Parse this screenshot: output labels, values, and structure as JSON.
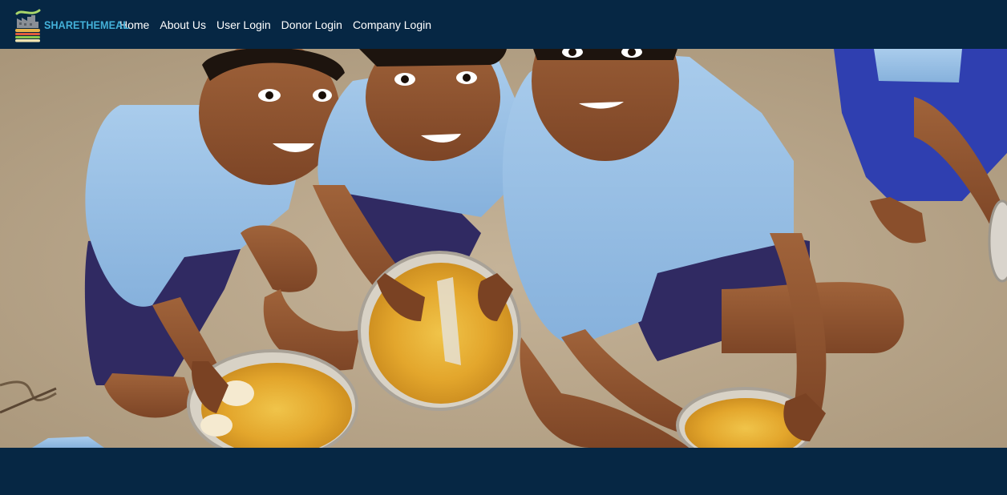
{
  "brand": {
    "logo_icon": "sharethemeal-logo-icon",
    "name": "SHARETHEMEAL",
    "accent_color": "#43b0d8"
  },
  "nav": {
    "background": "#062744",
    "items": [
      {
        "label": "Home"
      },
      {
        "label": "About Us"
      },
      {
        "label": "User Login"
      },
      {
        "label": "Donor Login"
      },
      {
        "label": "Company Login"
      }
    ]
  },
  "hero": {
    "image": "children-eating-meals-photo"
  }
}
